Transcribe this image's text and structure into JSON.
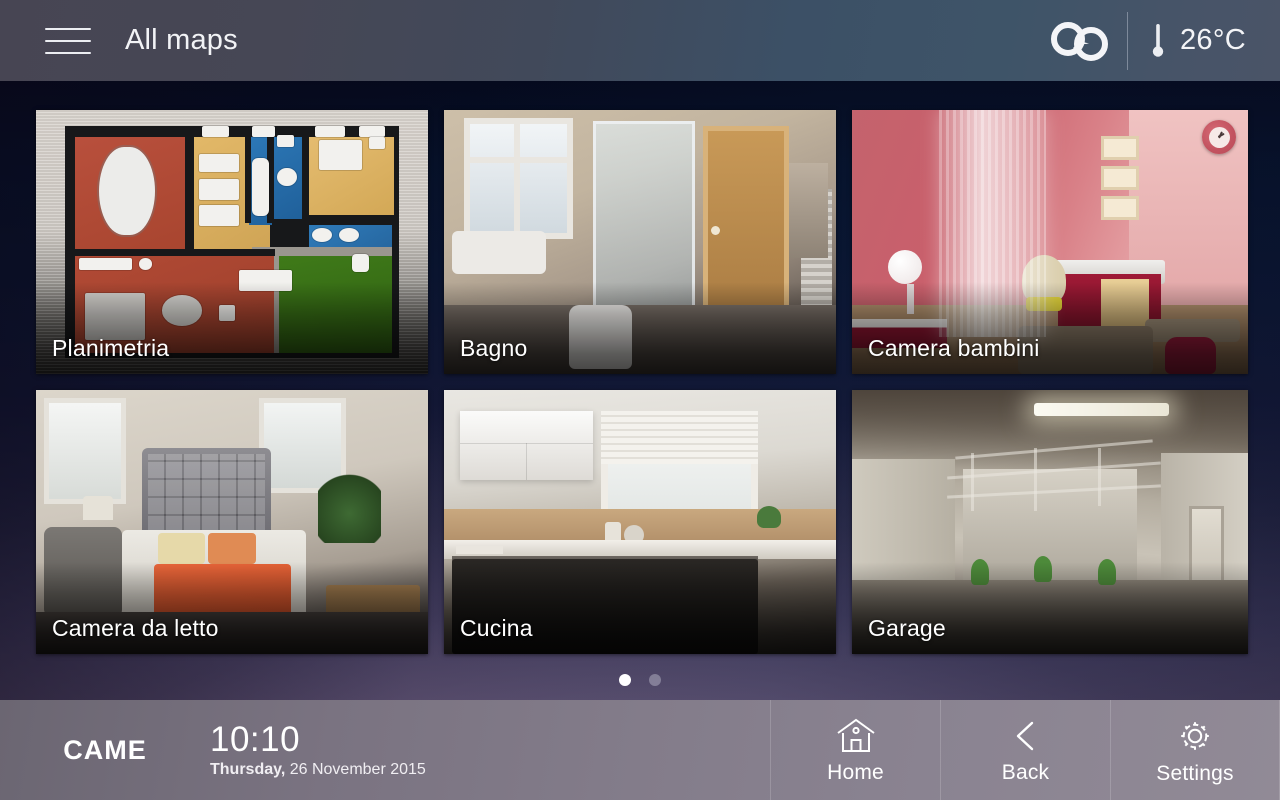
{
  "header": {
    "menu_icon": "hamburger-menu-icon",
    "title": "All maps",
    "weather_icon": "clouds-icon",
    "thermometer_icon": "thermometer-icon",
    "temperature": "26°C"
  },
  "cards": [
    {
      "label": "Planimetria",
      "art": "floorplan",
      "badge": null
    },
    {
      "label": "Bagno",
      "art": "bathroom",
      "badge": null
    },
    {
      "label": "Camera bambini",
      "art": "kids-room",
      "badge": "clock-icon"
    },
    {
      "label": "Camera da letto",
      "art": "bedroom",
      "badge": null
    },
    {
      "label": "Cucina",
      "art": "kitchen",
      "badge": null
    },
    {
      "label": "Garage",
      "art": "garage",
      "badge": null
    }
  ],
  "pagination": {
    "total": 2,
    "active": 1
  },
  "bottom": {
    "brand": "CAME",
    "time": "10:10",
    "date_weekday": "Thursday,",
    "date_rest": " 26 November 2015",
    "nav": [
      {
        "label": "Home",
        "icon": "home-icon"
      },
      {
        "label": "Back",
        "icon": "chevron-left-icon"
      },
      {
        "label": "Settings",
        "icon": "gear-icon"
      }
    ]
  },
  "colors": {
    "header_left": "#474553",
    "header_right": "#4a5467",
    "bottom_bar": "#837c8a",
    "accent_white": "#ffffff",
    "badge_red": "#c35360"
  }
}
